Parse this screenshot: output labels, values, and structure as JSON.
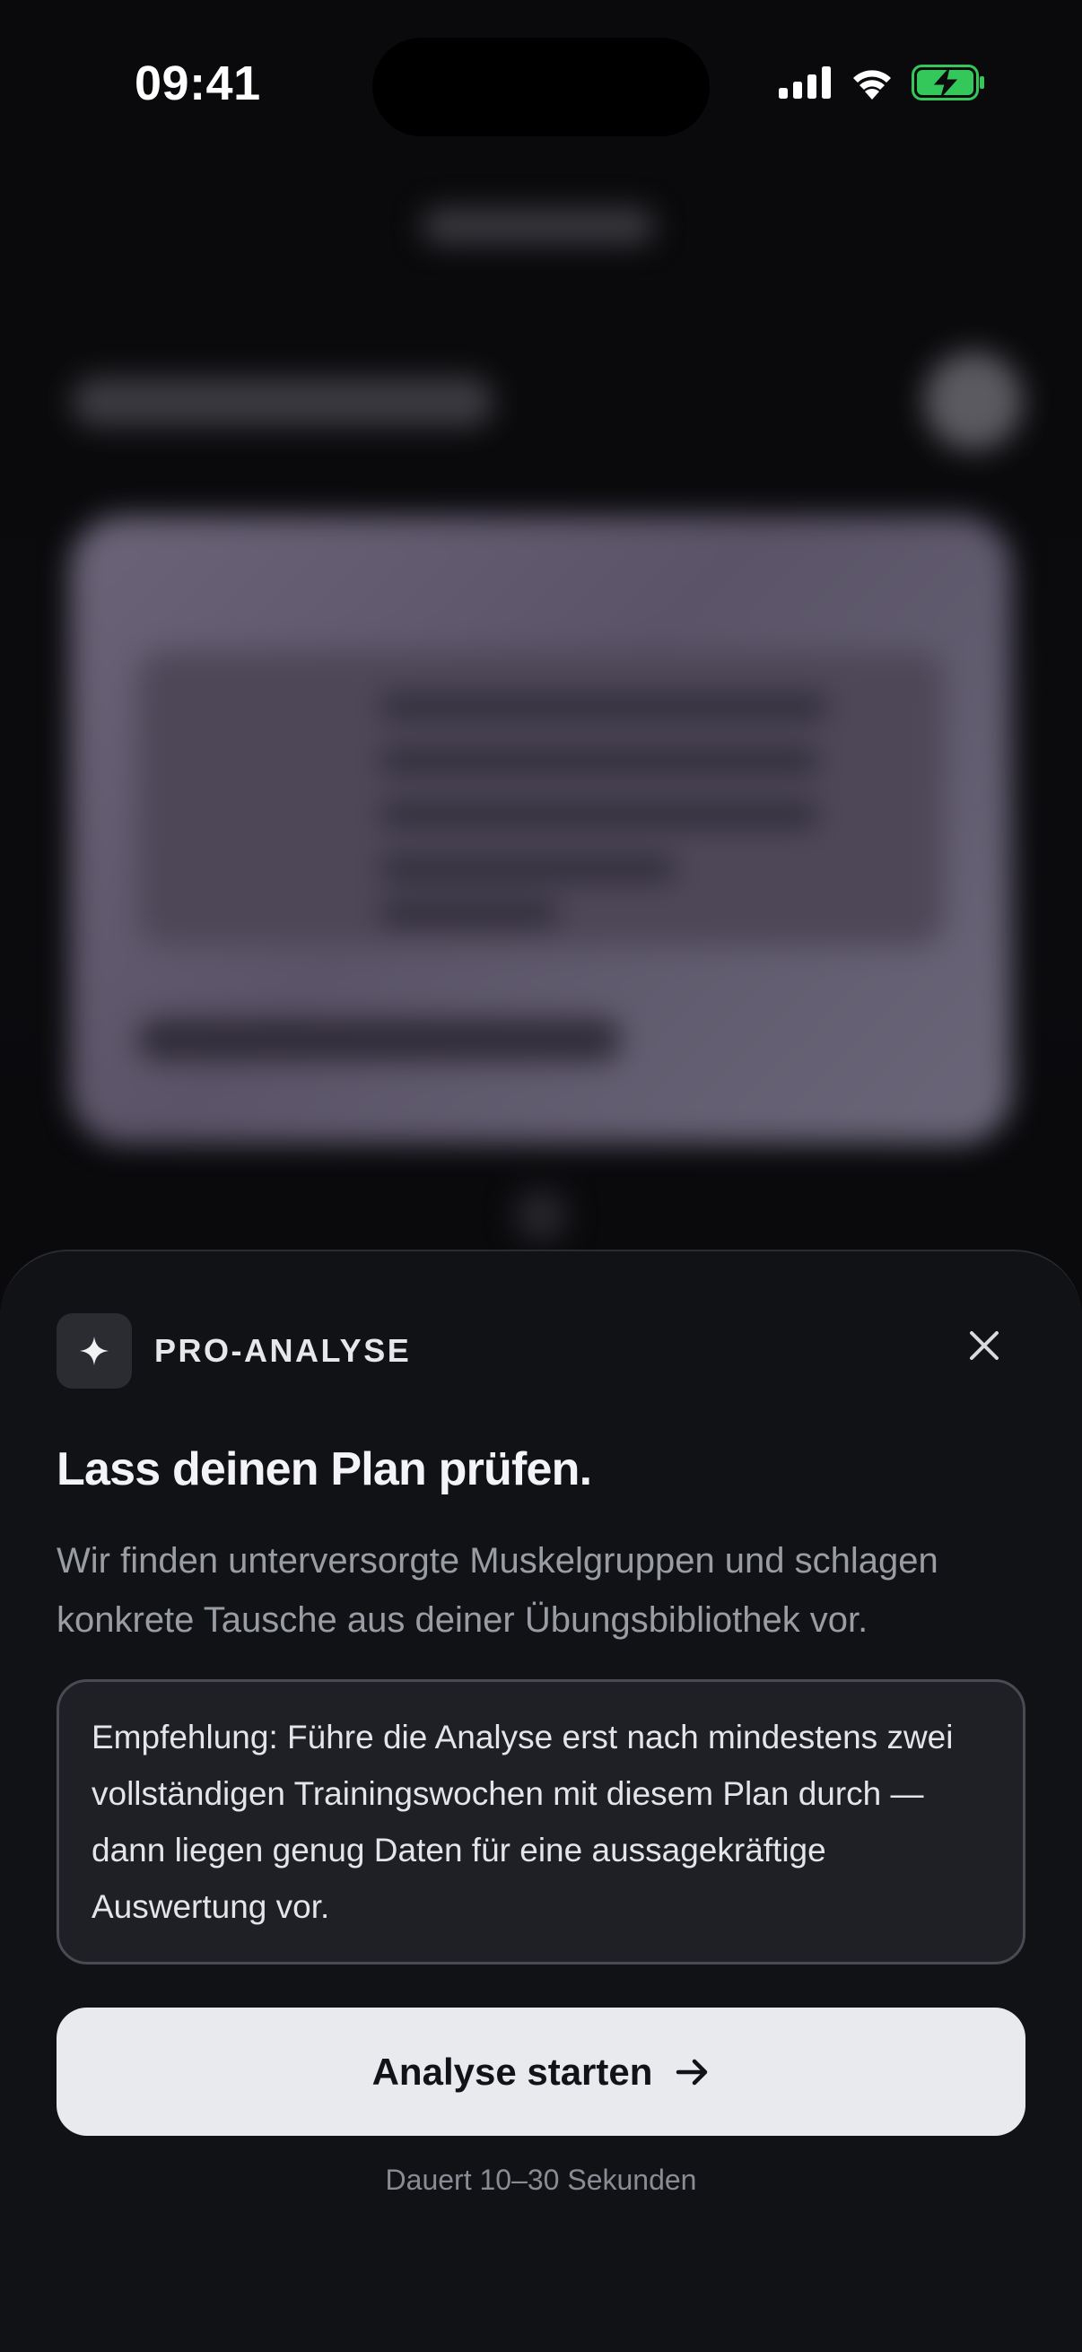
{
  "status_bar": {
    "time": "09:41"
  },
  "sheet": {
    "label": "PRO-ANALYSE",
    "title": "Lass deinen Plan prüfen.",
    "description": "Wir finden unterversorgte Muskelgruppen und schlagen konkrete Tausche aus deiner Übungsbibliothek vor.",
    "note": "Empfehlung: Führe die Analyse erst nach mindestens zwei vollständigen Trainingswochen mit diesem Plan durch — dann liegen genug Daten für eine aussagekräftige Auswertung vor.",
    "primary_button": "Analyse starten",
    "hint": "Dauert 10–30 Sekunden"
  },
  "icons": {
    "badge": "sparkle-icon",
    "close": "close-icon",
    "button": "arrow-right-icon",
    "status": [
      "cellular-signal-icon",
      "wifi-icon",
      "battery-charging-icon"
    ]
  },
  "colors": {
    "sheet_background": "#111216",
    "button_background": "#e9eaed",
    "battery_fill": "#34c759"
  }
}
